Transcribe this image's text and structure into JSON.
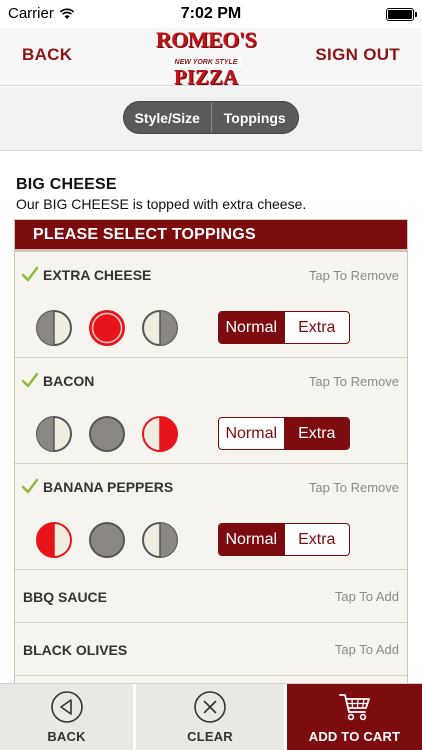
{
  "status_bar": {
    "carrier": "Carrier",
    "time": "7:02 PM"
  },
  "nav": {
    "back_label": "BACK",
    "sign_out_label": "SIGN OUT",
    "logo": {
      "top": "ROMEO'S",
      "middle": "NEW YORK STYLE",
      "bottom": "PIZZA"
    }
  },
  "segments": [
    {
      "label": "Style/Size"
    },
    {
      "label": "Toppings"
    }
  ],
  "item": {
    "title": "BIG CHEESE",
    "description": "Our BIG CHEESE is topped with extra cheese."
  },
  "panel_title": "PLEASE SELECT TOPPINGS",
  "toppings": [
    {
      "name": "EXTRA CHEESE",
      "action": "Tap To Remove",
      "portion_selected": "whole",
      "amount_options": [
        "Normal",
        "Extra"
      ],
      "amount_selected": "Normal"
    },
    {
      "name": "BACON",
      "action": "Tap To Remove",
      "portion_selected": "right",
      "amount_options": [
        "Normal",
        "Extra"
      ],
      "amount_selected": "Extra"
    },
    {
      "name": "BANANA PEPPERS",
      "action": "Tap To Remove",
      "portion_selected": "left",
      "amount_options": [
        "Normal",
        "Extra"
      ],
      "amount_selected": "Normal"
    }
  ],
  "available_toppings": [
    {
      "name": "BBQ SAUCE",
      "action": "Tap To Add"
    },
    {
      "name": "BLACK OLIVES",
      "action": "Tap To Add"
    }
  ],
  "toolbar": {
    "back_label": "BACK",
    "clear_label": "CLEAR",
    "add_to_cart_label": "ADD TO CART"
  },
  "colors": {
    "brand": "#7c0c10",
    "selected_red": "#e8141c",
    "check_green": "#8dbb3c"
  }
}
